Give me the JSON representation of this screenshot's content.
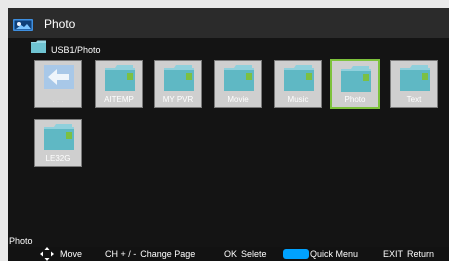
{
  "header": {
    "title": "Photo",
    "icon": "photo-app-icon"
  },
  "breadcrumb": {
    "path": "USB1/Photo",
    "icon": "folder-icon"
  },
  "items": [
    {
      "label": ". . .",
      "icon": "back-arrow-icon",
      "kind": "parent",
      "selected": false
    },
    {
      "label": "AITEMP",
      "icon": "folder-icon",
      "kind": "folder",
      "selected": false
    },
    {
      "label": "MY PVR",
      "icon": "folder-icon",
      "kind": "folder",
      "selected": false
    },
    {
      "label": "Movie",
      "icon": "folder-icon",
      "kind": "folder",
      "selected": false
    },
    {
      "label": "Music",
      "icon": "folder-icon",
      "kind": "folder",
      "selected": false
    },
    {
      "label": "Photo",
      "icon": "folder-icon",
      "kind": "folder",
      "selected": true
    },
    {
      "label": "Text",
      "icon": "folder-icon",
      "kind": "folder",
      "selected": false
    },
    {
      "label": "LE32G",
      "icon": "folder-icon",
      "kind": "folder",
      "selected": false
    }
  ],
  "status": {
    "label": "Photo"
  },
  "footer": {
    "move": "Move",
    "ch_key": "CH + / -",
    "change_page": "Change Page",
    "ok_key": "OK",
    "select": "Selete",
    "quick_menu": "Quick Menu",
    "exit_key": "EXIT",
    "return": "Return"
  },
  "colors": {
    "selection": "#7dc23c",
    "quick_menu_key": "#00a2ff",
    "folder": "#5fb8c4",
    "folder_accent": "#7bc043"
  }
}
